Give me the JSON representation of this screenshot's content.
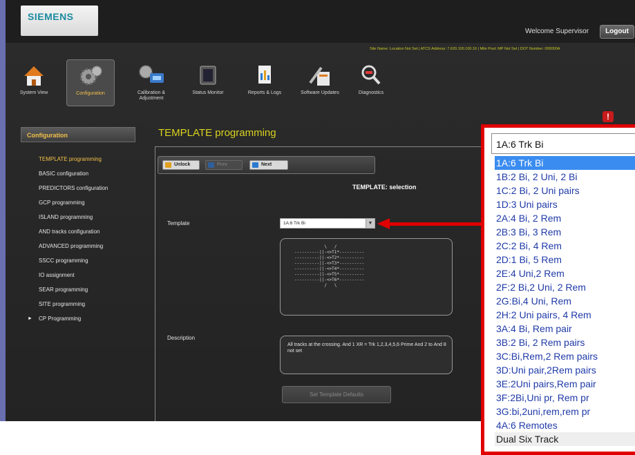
{
  "header": {
    "logo": "SIEMENS",
    "welcome": "Welcome Supervisor",
    "logout": "Logout",
    "site_info": "Site Name: Location Not Set | ATCS Address: 7.620.100.100.16 | Mile Post: MP Not Set | DOT Number: 000000A"
  },
  "toolbar": [
    {
      "label": "System View",
      "icon": "house-icon"
    },
    {
      "label": "Configuration",
      "icon": "gears-icon"
    },
    {
      "label": "Calibration & Adjustment",
      "icon": "calibration-icon"
    },
    {
      "label": "Status Monitor",
      "icon": "monitor-icon"
    },
    {
      "label": "Reports & Logs",
      "icon": "reports-icon"
    },
    {
      "label": "Software Updates",
      "icon": "software-icon"
    },
    {
      "label": "Diagnostics",
      "icon": "diagnostics-icon"
    }
  ],
  "alert_icon": "!",
  "sidebar": {
    "header": "Configuration",
    "items": [
      "TEMPLATE programming",
      "BASIC configuration",
      "PREDICTORS configuration",
      "GCP programming",
      "ISLAND programming",
      "AND tracks configuration",
      "ADVANCED programming",
      "SSCC programming",
      "IO assignment",
      "SEAR programming",
      "SITE programming",
      "CP Programming"
    ]
  },
  "main": {
    "title": "TEMPLATE programming",
    "buttons": {
      "unlock": "Unlock",
      "prev": "Prev",
      "next": "Next"
    },
    "selection_heading": "TEMPLATE: selection",
    "template_label": "Template",
    "template_value": "1A:6 Trk Bi",
    "diagram_text": "            \\   /\n----------||-<>T1*----------\n----------||-<>T2*----------\n----------||-<>T3*----------\n----------||-<>T4*----------\n----------||-<>T5*----------\n----------||-<>T6*----------\n            /   \\",
    "description_label": "Description",
    "description": "All tracks at the crossing. And 1 XR = Trk 1,2,3,4,5,6 Prime And 2 to And 8 not set",
    "set_defaults": "Set Template Defaults"
  },
  "dropdown": {
    "current": "1A:6 Trk Bi",
    "options": [
      "1A:6 Trk Bi",
      "1B:2 Bi, 2 Uni, 2 Bi",
      "1C:2 Bi, 2 Uni pairs",
      "1D:3 Uni pairs",
      "2A:4 Bi, 2 Rem",
      "2B:3 Bi, 3 Rem",
      "2C:2 Bi, 4 Rem",
      "2D:1 Bi, 5 Rem",
      "2E:4 Uni,2 Rem",
      "2F:2 Bi,2 Uni, 2 Rem",
      "2G:Bi,4 Uni, Rem",
      "2H:2 Uni pairs, 4 Rem",
      "3A:4 Bi, Rem pair",
      "3B:2 Bi, 2 Rem pairs",
      "3C:Bi,Rem,2 Rem pairs",
      "3D:Uni pair,2Rem pairs",
      "3E:2Uni pairs,Rem pair",
      "3F:2Bi,Uni pr, Rem pr",
      "3G:bi,2uni,rem,rem pr",
      "4A:6 Remotes",
      "Dual Six Track"
    ]
  }
}
